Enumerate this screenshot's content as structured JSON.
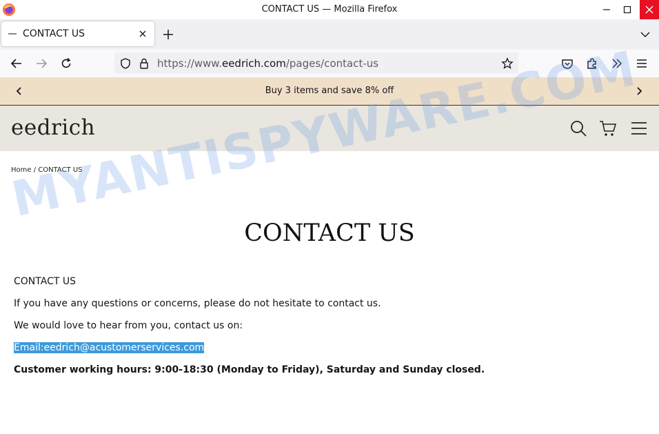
{
  "window": {
    "title": "CONTACT US — Mozilla Firefox"
  },
  "browser": {
    "tab": {
      "label": "CONTACT US"
    },
    "url": {
      "prefix": "https://www.",
      "domain": "eedrich.com",
      "path": "/pages/contact-us"
    }
  },
  "site": {
    "announcement": "Buy 3 items and save 8% off",
    "logo": "eedrich",
    "breadcrumb": "Home / CONTACT US",
    "page_title": "CONTACT US",
    "content": {
      "heading": "CONTACT US",
      "para1": "If you have any questions or concerns, please do not hesitate to contact us.",
      "para2": "We would love to hear from you, contact us on:",
      "email": "Email:eedrich@acustomerservices.com",
      "hours": "Customer working hours: 9:00-18:30 (Monday to Friday), Saturday and Sunday closed."
    }
  },
  "watermark": "MYANTISPYWARE.COM"
}
